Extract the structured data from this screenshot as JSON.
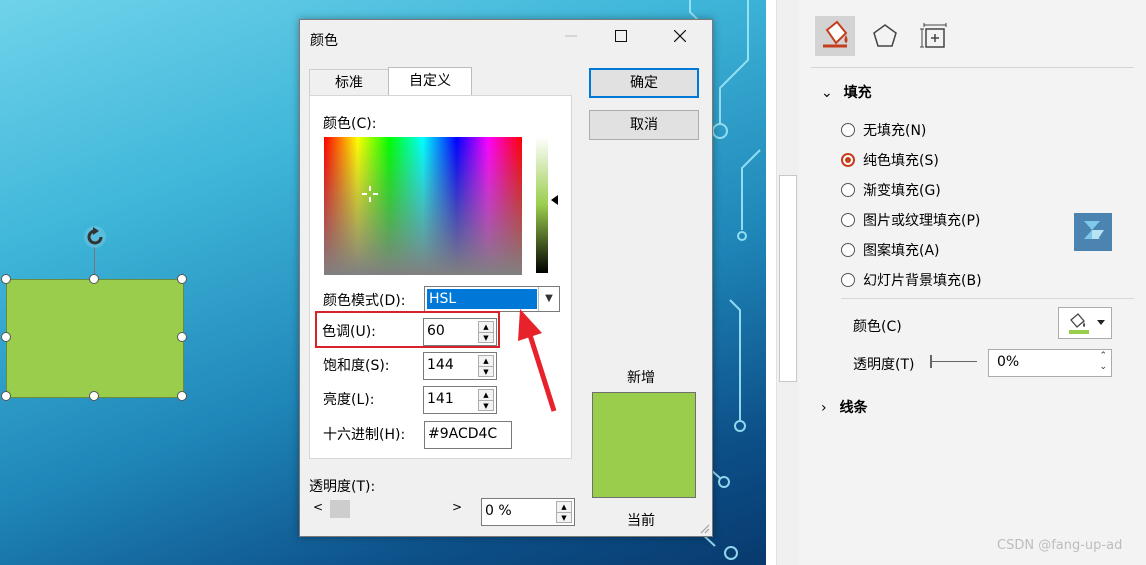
{
  "dialog": {
    "title": "颜色",
    "tabs": [
      {
        "label": "标准"
      },
      {
        "label": "自定义"
      }
    ],
    "colors_label": "颜色(C):",
    "color_mode_label": "颜色模式(D):",
    "color_mode_value": "HSL",
    "hue_label": "色调(U):",
    "hue_value": "60",
    "saturation_label": "饱和度(S):",
    "saturation_value": "144",
    "luminance_label": "亮度(L):",
    "luminance_value": "141",
    "hex_label": "十六进制(H):",
    "hex_value": "#9ACD4C",
    "transparency_label": "透明度(T):",
    "transparency_value": "0 %",
    "ok_label": "确定",
    "cancel_label": "取消",
    "new_label": "新增",
    "current_label": "当前",
    "preview_color": "#9ACD4C"
  },
  "shape": {
    "fill_color": "#9ACD4C"
  },
  "pane": {
    "fill_section": "填充",
    "fill_options": [
      {
        "label": "无填充(N)",
        "selected": false
      },
      {
        "label": "纯色填充(S)",
        "selected": true
      },
      {
        "label": "渐变填充(G)",
        "selected": false
      },
      {
        "label": "图片或纹理填充(P)",
        "selected": false
      },
      {
        "label": "图案填充(A)",
        "selected": false
      },
      {
        "label": "幻灯片背景填充(B)",
        "selected": false
      }
    ],
    "color_label": "颜色(C)",
    "transparency_label": "透明度(T)",
    "transparency_value": "0%",
    "line_section": "线条"
  },
  "watermark": "CSDN @fang-up-ad"
}
